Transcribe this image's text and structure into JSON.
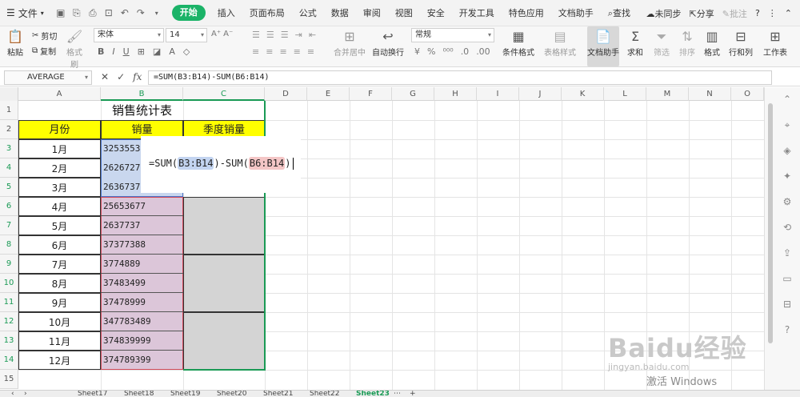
{
  "menu": {
    "file_label": "文件",
    "tabs": [
      "开始",
      "插入",
      "页面布局",
      "公式",
      "数据",
      "审阅",
      "视图",
      "安全",
      "开发工具",
      "特色应用",
      "文档助手"
    ],
    "search_label": "查找",
    "right": {
      "sync": "未同步",
      "share": "分享",
      "comment": "批注"
    }
  },
  "toolbar": {
    "paste": "粘贴",
    "cut": "剪切",
    "copy": "复制",
    "format_painter": "格式刷",
    "font_name": "宋体",
    "font_size": "14",
    "merge_center": "合并居中",
    "wrap": "自动换行",
    "number_format": "常规",
    "cond_format": "条件格式",
    "table_style": "表格样式",
    "doc_helper": "文档助手",
    "sum": "求和",
    "filter": "筛选",
    "sort": "排序",
    "format": "格式",
    "rows_cols": "行和列",
    "worksheet": "工作表"
  },
  "formula_bar": {
    "name_box": "AVERAGE",
    "formula": "=SUM(B3:B14)-SUM(B6:B14)"
  },
  "grid": {
    "columns": [
      "A",
      "B",
      "C",
      "D",
      "E",
      "F",
      "G",
      "H",
      "I",
      "J",
      "K",
      "L",
      "M",
      "N",
      "O"
    ],
    "rows": [
      "1",
      "2",
      "3",
      "4",
      "5",
      "6",
      "7",
      "8",
      "9",
      "10",
      "11",
      "12",
      "13",
      "14",
      "15"
    ],
    "title": "销售统计表",
    "headers": {
      "month": "月份",
      "sales": "销量",
      "quarter": "季度销量"
    },
    "months": [
      "1月",
      "2月",
      "3月",
      "4月",
      "5月",
      "6月",
      "7月",
      "8月",
      "9月",
      "10月",
      "11月",
      "12月"
    ],
    "sales": [
      "3253553",
      "2626727",
      "2636737",
      "25653677",
      "2637737",
      "37377388",
      "3774889",
      "37483499",
      "37478999",
      "347783489",
      "374839999",
      "374789399"
    ]
  },
  "popup_formula": {
    "prefix": "=SUM(",
    "ref1": "B3:B14",
    "mid": ")-SUM(",
    "ref2": "B6:B14",
    "suffix": ")"
  },
  "sheets": [
    "Sheet17",
    "Sheet18",
    "Sheet19",
    "Sheet20",
    "Sheet21",
    "Sheet22",
    "Sheet23"
  ],
  "watermark": {
    "brand": "Baidu经验",
    "url": "jingyan.baidu.com"
  },
  "activate_text": "激活 Windows"
}
